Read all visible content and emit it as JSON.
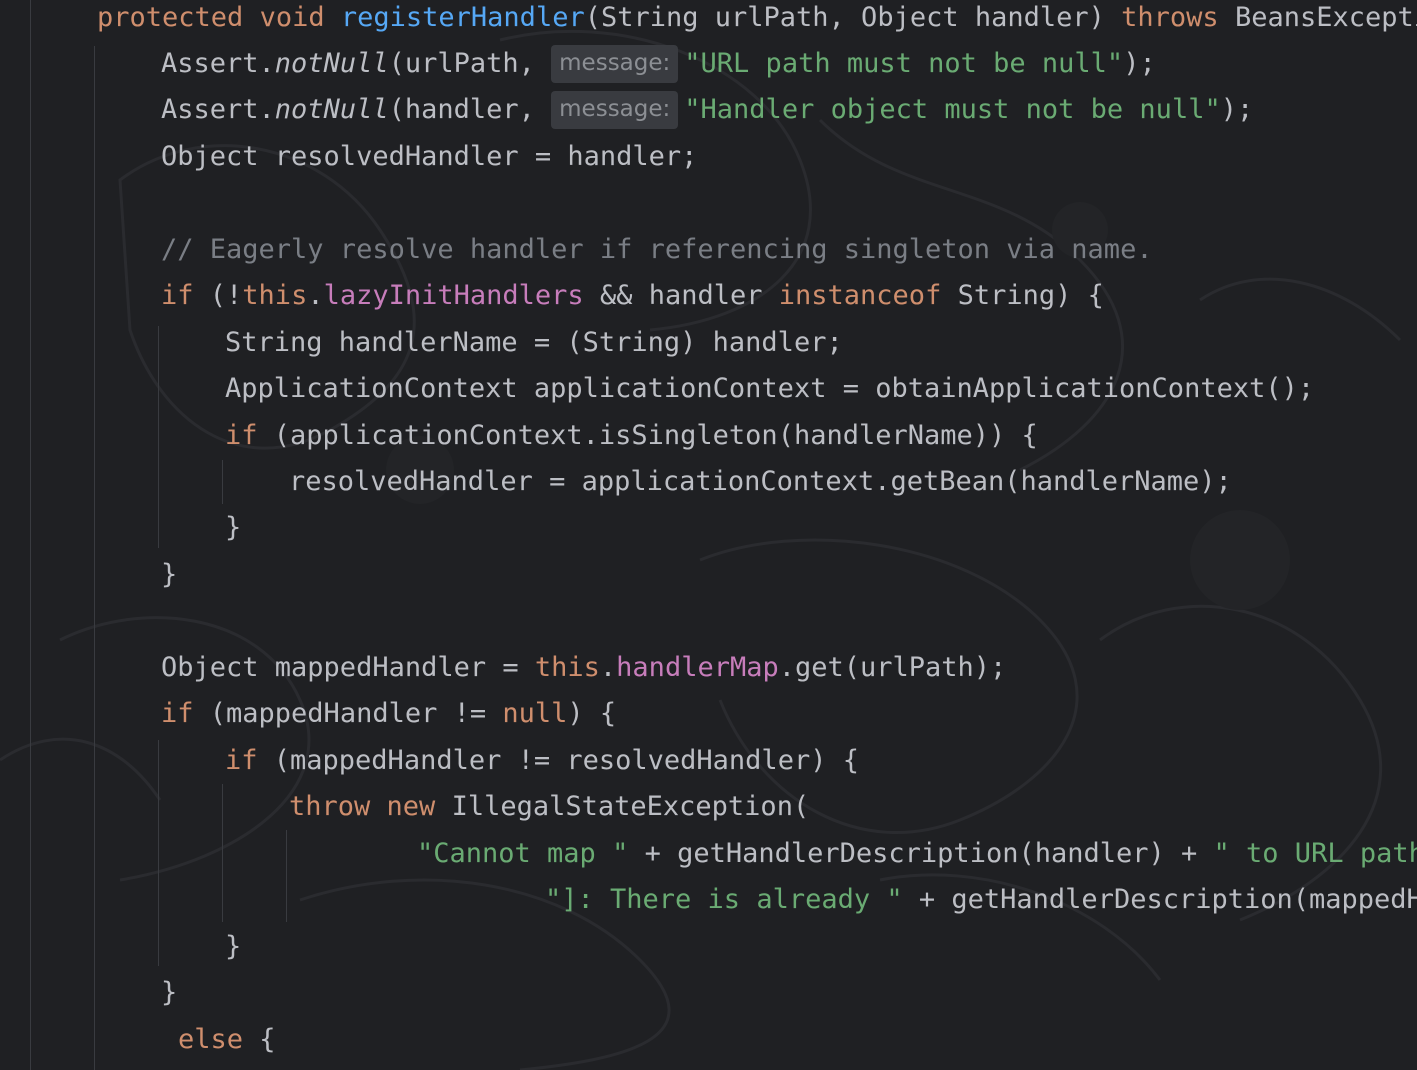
{
  "theme": {
    "background": "#1f2023",
    "keyword": "#cf8e6d",
    "function": "#56a8f5",
    "string": "#6aab73",
    "comment": "#7a7e85",
    "field": "#c77dbb",
    "text": "#bcbec4"
  },
  "hint_label": "message:",
  "lines": [
    {
      "a": "protected",
      "b": " ",
      "c": "void",
      "d": " ",
      "e": "registerHandler",
      "f": "(String urlPath, Object handler) ",
      "g": "throws",
      "h": " BeansExceptio"
    },
    {
      "a": "Assert.",
      "b": "notNull",
      "c": "(urlPath, ",
      "d": "\"URL path must not be null\"",
      "e": ");"
    },
    {
      "a": "Assert.",
      "b": "notNull",
      "c": "(handler, ",
      "d": "\"Handler object must not be null\"",
      "e": ");"
    },
    {
      "a": "Object resolvedHandler = handler;"
    },
    {
      "a": "// Eagerly resolve handler if referencing singleton via name."
    },
    {
      "a": "if",
      "b": " (!",
      "c": "this",
      "d": ".",
      "e": "lazyInitHandlers",
      "f": " && handler ",
      "g": "instanceof",
      "h": " String) {"
    },
    {
      "a": "String handlerName = (String) handler;"
    },
    {
      "a": "ApplicationContext applicationContext = obtainApplicationContext();"
    },
    {
      "a": "if",
      "b": " (applicationContext.isSingleton(handlerName)) {"
    },
    {
      "a": "resolvedHandler = applicationContext.getBean(handlerName);"
    },
    {
      "a": "}"
    },
    {
      "a": "}"
    },
    {
      "a": "Object mappedHandler = ",
      "b": "this",
      "c": ".",
      "d": "handlerMap",
      "e": ".get(urlPath);"
    },
    {
      "a": "if",
      "b": " (mappedHandler != ",
      "c": "null",
      "d": ") {"
    },
    {
      "a": "if",
      "b": " (mappedHandler != resolvedHandler) {"
    },
    {
      "a": "throw",
      "b": " ",
      "c": "new",
      "d": " IllegalStateException("
    },
    {
      "a": "\"Cannot map \"",
      "b": " + getHandlerDescription(handler) + ",
      "c": "\" to URL path"
    },
    {
      "a": "\"]: There is already \"",
      "b": " + getHandlerDescription(mappedHa"
    },
    {
      "a": "}"
    },
    {
      "a": "}"
    },
    {
      "a": "else",
      "b": " {"
    }
  ]
}
